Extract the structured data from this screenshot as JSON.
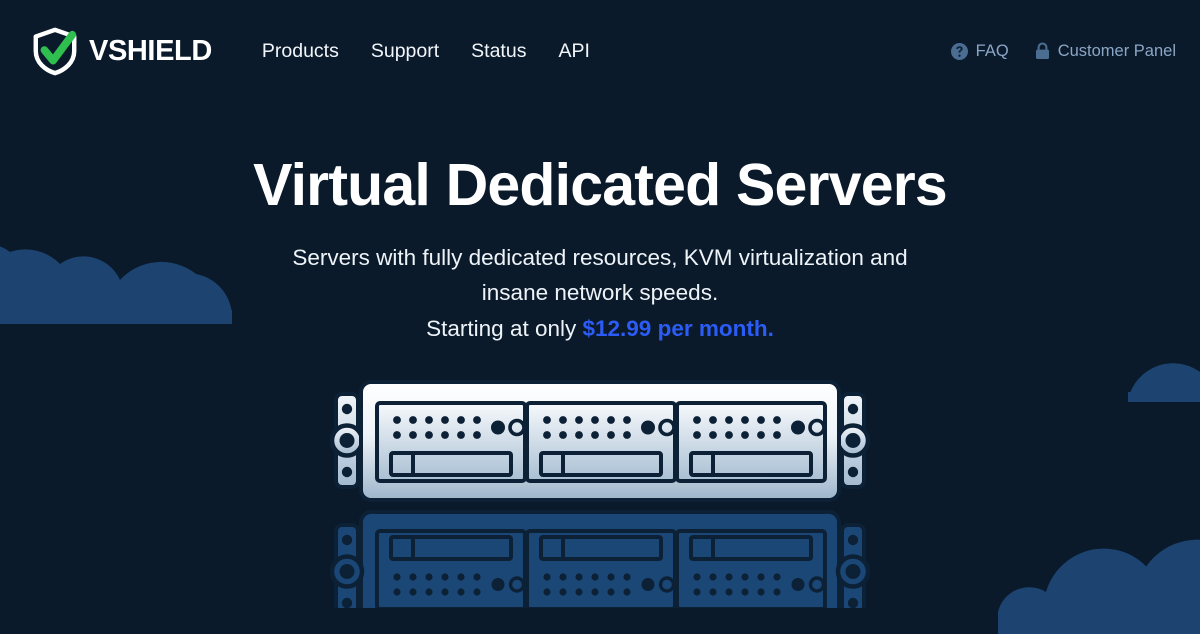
{
  "header": {
    "brand": {
      "name": "VSHIELD",
      "logo_icon": "shield-check-icon",
      "shield_color": "#ffffff",
      "check_color": "#2fbf4f"
    },
    "nav": [
      {
        "label": "Products",
        "name": "products"
      },
      {
        "label": "Support",
        "name": "support"
      },
      {
        "label": "Status",
        "name": "status"
      },
      {
        "label": "API",
        "name": "api"
      }
    ],
    "utility_nav": [
      {
        "label": "FAQ",
        "name": "faq",
        "icon": "question-circle-icon"
      },
      {
        "label": "Customer Panel",
        "name": "customer-panel",
        "icon": "lock-icon"
      }
    ]
  },
  "hero": {
    "title": "Virtual Dedicated Servers",
    "subtitle_line1": "Servers with fully dedicated resources, KVM virtualization and",
    "subtitle_line2": "insane network speeds.",
    "price_prefix": "Starting at only ",
    "price": "$12.99 per month.",
    "illustration": "rack-server-icon"
  },
  "theme": {
    "background": "#0a1a2b",
    "accent_blue": "#2c5cf6",
    "muted_text": "#8ba6c4",
    "cloud_fill": "#1d4470",
    "reflection_fill": "#1b4776",
    "server_body_light": "#ffffff",
    "server_body_shade": "#9fb6cc",
    "server_outline": "#0d2136"
  }
}
